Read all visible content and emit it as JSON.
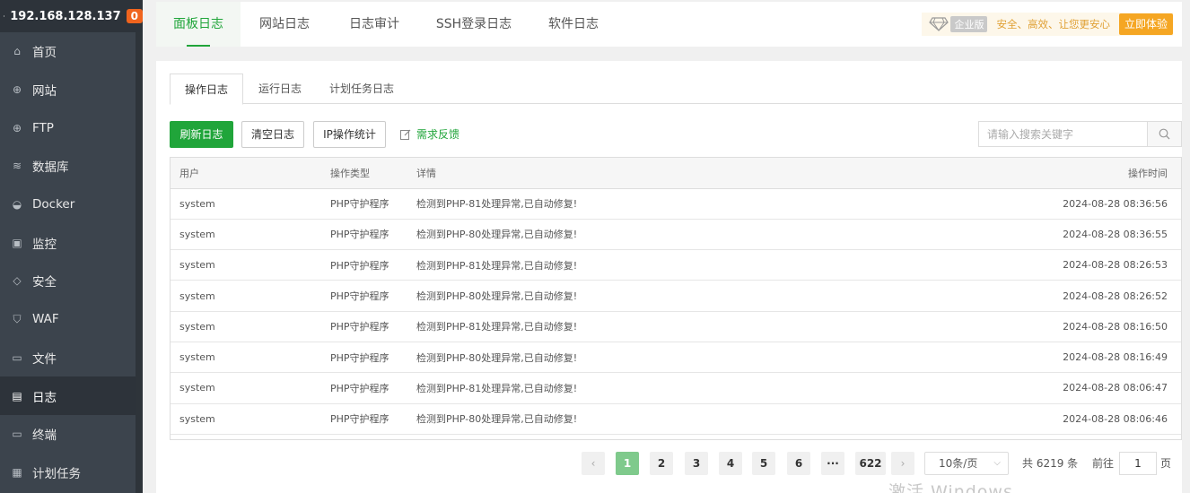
{
  "sidebar": {
    "ip": "192.168.128.137",
    "badge": "0",
    "items": [
      {
        "label": "首页",
        "icon": "home-icon"
      },
      {
        "label": "网站",
        "icon": "globe-icon"
      },
      {
        "label": "FTP",
        "icon": "ftp-globe-icon"
      },
      {
        "label": "数据库",
        "icon": "database-icon"
      },
      {
        "label": "Docker",
        "icon": "docker-icon"
      },
      {
        "label": "监控",
        "icon": "monitor-icon"
      },
      {
        "label": "安全",
        "icon": "shield-check-icon"
      },
      {
        "label": "WAF",
        "icon": "shield-icon"
      },
      {
        "label": "文件",
        "icon": "folder-icon"
      },
      {
        "label": "日志",
        "icon": "log-icon",
        "active": true
      },
      {
        "label": "终端",
        "icon": "terminal-icon"
      },
      {
        "label": "计划任务",
        "icon": "calendar-icon"
      }
    ]
  },
  "top_tabs": [
    "面板日志",
    "网站日志",
    "日志审计",
    "SSH登录日志",
    "软件日志"
  ],
  "enterprise": {
    "tag": "企业版",
    "slogan": "安全、高效、让您更安心",
    "button": "立即体验"
  },
  "sub_tabs": [
    "操作日志",
    "运行日志",
    "计划任务日志"
  ],
  "toolbar": {
    "refresh": "刷新日志",
    "clear": "清空日志",
    "ip_stats": "IP操作统计",
    "feedback": "需求反馈",
    "search_placeholder": "请输入搜索关键字"
  },
  "table": {
    "headers": [
      "用户",
      "操作类型",
      "详情",
      "操作时间"
    ],
    "rows": [
      [
        "system",
        "PHP守护程序",
        "检测到PHP-81处理异常,已自动修复!",
        "2024-08-28 08:36:56"
      ],
      [
        "system",
        "PHP守护程序",
        "检测到PHP-80处理异常,已自动修复!",
        "2024-08-28 08:36:55"
      ],
      [
        "system",
        "PHP守护程序",
        "检测到PHP-81处理异常,已自动修复!",
        "2024-08-28 08:26:53"
      ],
      [
        "system",
        "PHP守护程序",
        "检测到PHP-80处理异常,已自动修复!",
        "2024-08-28 08:26:52"
      ],
      [
        "system",
        "PHP守护程序",
        "检测到PHP-81处理异常,已自动修复!",
        "2024-08-28 08:16:50"
      ],
      [
        "system",
        "PHP守护程序",
        "检测到PHP-80处理异常,已自动修复!",
        "2024-08-28 08:16:49"
      ],
      [
        "system",
        "PHP守护程序",
        "检测到PHP-81处理异常,已自动修复!",
        "2024-08-28 08:06:47"
      ],
      [
        "system",
        "PHP守护程序",
        "检测到PHP-80处理异常,已自动修复!",
        "2024-08-28 08:06:46"
      ]
    ]
  },
  "pagination": {
    "pages": [
      "1",
      "2",
      "3",
      "4",
      "5",
      "6",
      "···",
      "622"
    ],
    "current": "1",
    "page_size": "10条/页",
    "total": "共 6219 条",
    "goto_label": "前往",
    "goto_value": "1",
    "page_unit": "页"
  },
  "watermark": "激活 Windows"
}
